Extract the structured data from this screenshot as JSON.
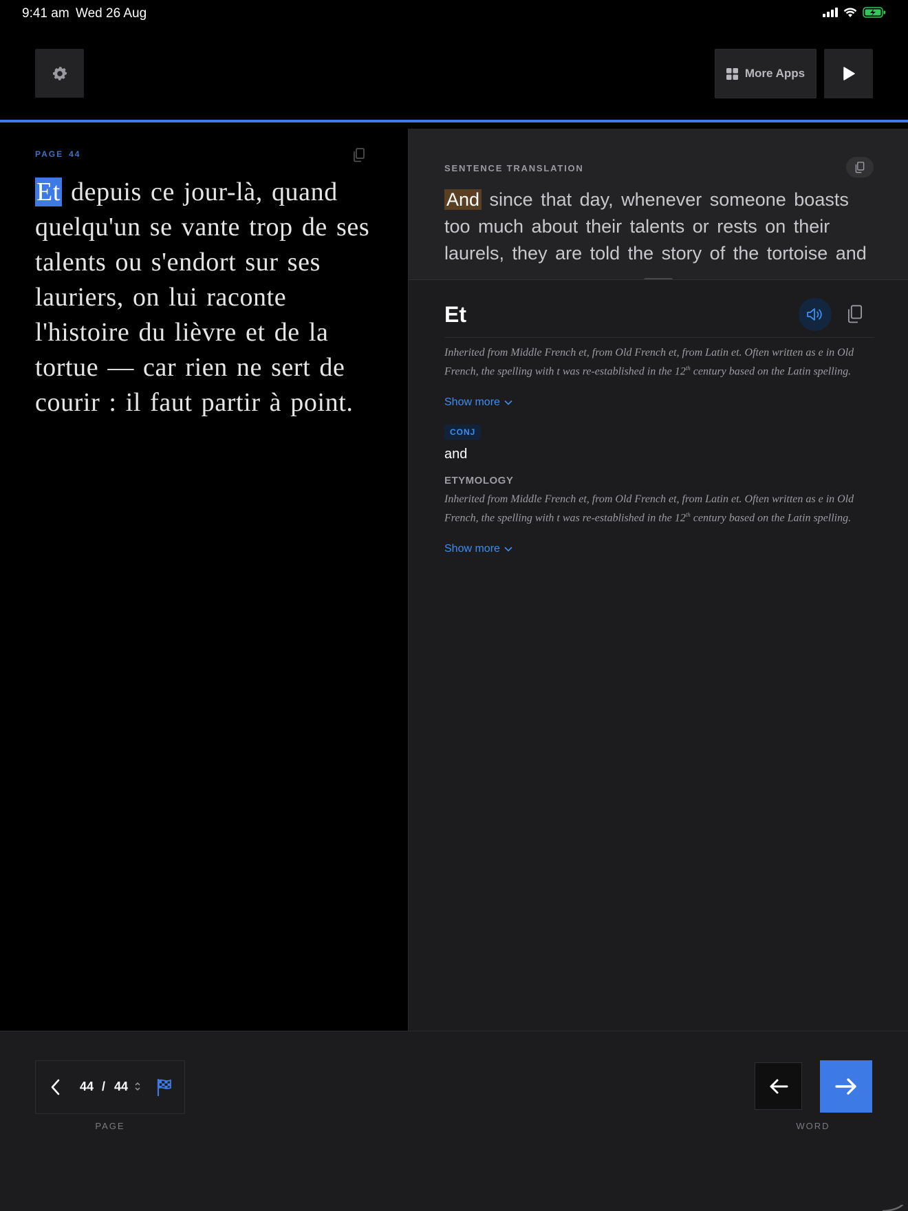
{
  "status_bar": {
    "time": "9:41 am",
    "date": "Wed 26 Aug"
  },
  "header": {
    "more_apps_label": "More Apps"
  },
  "progress": {
    "fraction": 1.0
  },
  "source": {
    "page_label": "PAGE",
    "page_number": "44",
    "highlighted_word": "Et",
    "text_rest": " depuis ce jour-là, quand quelqu'un se vante trop de ses talents ou s'endort sur ses lauriers, on lui raconte l'histoire du lièvre et de la tortue — car rien ne sert de courir : il faut partir à point."
  },
  "translation": {
    "label": "SENTENCE TRANSLATION",
    "highlighted_word": "And",
    "text_rest": " since that day, whenever someone boasts too much about their talents or rests on their laurels, they are told the story of the tortoise and the hare — for there is no point in running: you must set off on time."
  },
  "word": {
    "title": "Et",
    "etymology_intro": {
      "before_sup": "Inherited from Middle French et, from Old French et, from Latin et. Often written as e in Old French, the spelling with t was re-established in the 12",
      "sup": "th",
      "after_sup": " century based on the Latin spelling."
    },
    "show_more_label": "Show more",
    "pos": "CONJ",
    "meaning": "and",
    "etymology_heading": "ETYMOLOGY",
    "etymology": {
      "before_sup": "Inherited from Middle French et, from Old French et, from Latin et. Often written as e in Old French, the spelling with t was re-established in the 12",
      "sup": "th",
      "after_sup": " century based on the Latin spelling."
    }
  },
  "bottom": {
    "page_current": "44",
    "page_separator": "/",
    "page_total": "44",
    "page_caption": "PAGE",
    "word_caption": "WORD"
  },
  "colors": {
    "accent": "#3e7ae6",
    "link": "#3d8ef0",
    "translation_highlight": "#5a3f22",
    "battery": "#34c759"
  },
  "icons": [
    "gear-icon",
    "grid-icon",
    "play-icon",
    "copy-icon",
    "speaker-icon",
    "chevron-down-icon",
    "chevron-left-icon",
    "stepper-icon",
    "checkered-flag-icon",
    "arrow-left-icon",
    "arrow-right-icon",
    "wifi-icon",
    "battery-icon",
    "signal-icon"
  ]
}
